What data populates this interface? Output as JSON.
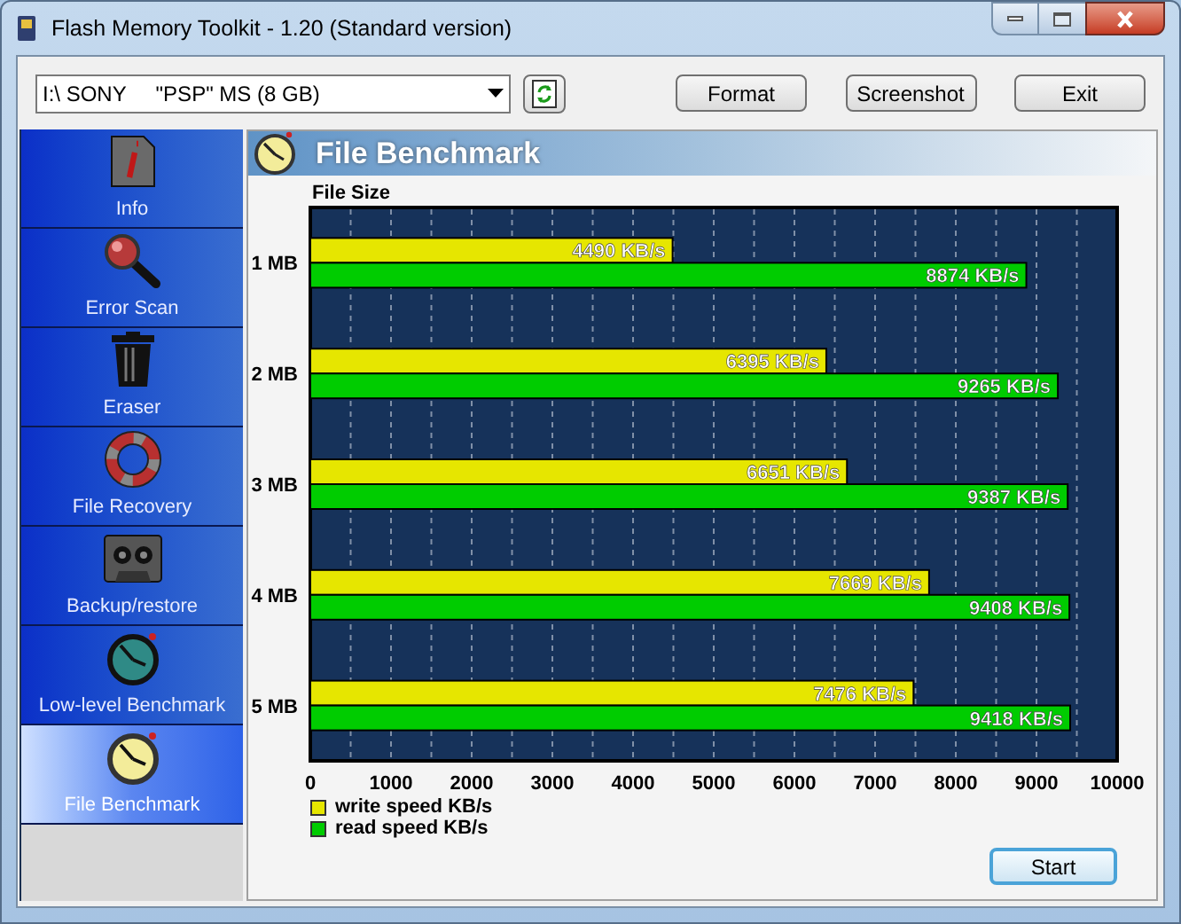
{
  "window": {
    "title": "Flash Memory Toolkit - 1.20 (Standard version)"
  },
  "toolbar": {
    "drive": "I:\\ SONY     \"PSP\" MS (8 GB)",
    "buttons": [
      "Format",
      "Screenshot",
      "Exit"
    ]
  },
  "sidebar": {
    "items": [
      {
        "label": "Info",
        "selected": false
      },
      {
        "label": "Error Scan",
        "selected": false
      },
      {
        "label": "Eraser",
        "selected": false
      },
      {
        "label": "File Recovery",
        "selected": false
      },
      {
        "label": "Backup/restore",
        "selected": false
      },
      {
        "label": "Low-level Benchmark",
        "selected": false
      },
      {
        "label": "File Benchmark",
        "selected": true
      }
    ]
  },
  "panel": {
    "title": "File Benchmark",
    "chart_data": {
      "type": "bar",
      "orientation": "horizontal",
      "ylabel": "File Size",
      "categories": [
        "1 MB",
        "2 MB",
        "3 MB",
        "4 MB",
        "5 MB"
      ],
      "series": [
        {
          "name": "write speed KB/s",
          "color": "#e6e600",
          "values": [
            4490,
            6395,
            6651,
            7669,
            7476
          ],
          "value_labels": [
            "4490 KB/s",
            "6395 KB/s",
            "6651 KB/s",
            "7669 KB/s",
            "7476 KB/s"
          ]
        },
        {
          "name": "read speed KB/s",
          "color": "#00cc00",
          "values": [
            8874,
            9265,
            9387,
            9408,
            9418
          ],
          "value_labels": [
            "8874 KB/s",
            "9265 KB/s",
            "9387 KB/s",
            "9408 KB/s",
            "9418 KB/s"
          ]
        }
      ],
      "xlim": [
        0,
        10000
      ],
      "xticks": [
        0,
        1000,
        2000,
        3000,
        4000,
        5000,
        6000,
        7000,
        8000,
        9000,
        10000
      ],
      "data_labels": true,
      "grid": true
    },
    "start_button": "Start"
  }
}
